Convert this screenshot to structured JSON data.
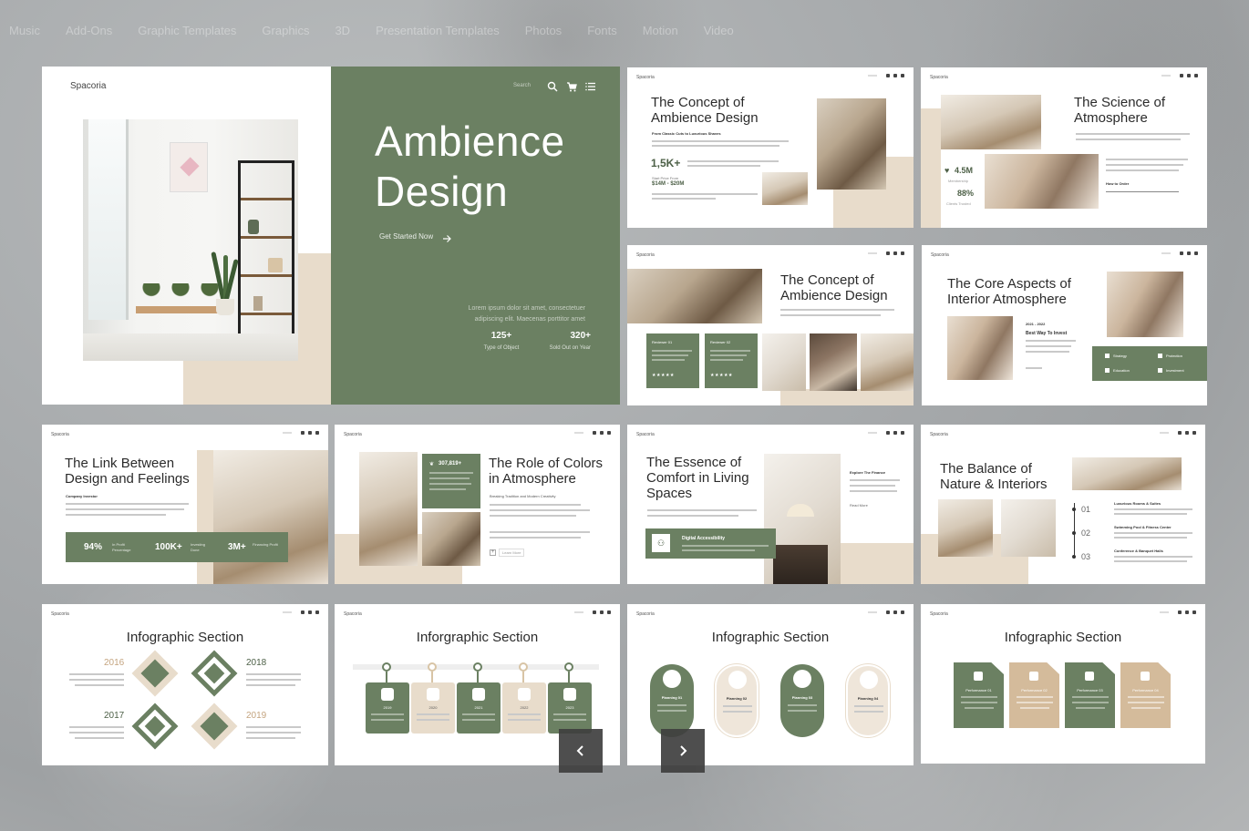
{
  "topnav": [
    "Music",
    "Add-Ons",
    "Graphic Templates",
    "Graphics",
    "3D",
    "Presentation Templates",
    "Photos",
    "Fonts",
    "Motion",
    "Video"
  ],
  "hero": {
    "logo": "Spacoria",
    "search": "Search",
    "title_line1": "Ambience",
    "title_line2": "Design",
    "cta": "Get Started Now",
    "lorem_line1": "Lorem ipsum dolor sit amet, consectetuer",
    "lorem_line2": "adipiscing elit. Maecenas porttitor amet",
    "stat1_value": "125+",
    "stat1_label": "Type of Object",
    "stat2_value": "320+",
    "stat2_label": "Sold Out on Year"
  },
  "slides": {
    "s1": {
      "logo": "Spacoria",
      "title1": "The Concept of",
      "title2": "Ambience Design",
      "sub": "From Classic Cuts to Luxurious Shaves",
      "stat": "1,5K+",
      "range_label": "Start Price From",
      "range": "$14M - $20M"
    },
    "s2": {
      "logo": "Spacoria",
      "title1": "The Science of",
      "title2": "Atmosphere",
      "stat1": "4.5M",
      "stat1_label": "Membership",
      "stat2": "88%",
      "stat2_label": "Clients Trusted",
      "order": "How to Order"
    },
    "s3": {
      "logo": "Spacoria",
      "title1": "The Concept of",
      "title2": "Ambience Design",
      "card1": "Reviewer 01",
      "card2": "Reviewer 02",
      "stars": "★★★★★"
    },
    "s4": {
      "logo": "Spacoria",
      "title1": "The Core Aspects of",
      "title2": "Interior Atmosphere",
      "years": "2021 - 2022",
      "best": "Best Way To Invest",
      "chips": [
        "Strategy",
        "Protection",
        "Education",
        "Investment"
      ]
    },
    "s5": {
      "logo": "Spacoria",
      "title1": "The Link Between",
      "title2": "Design and Feelings",
      "company": "Company Investor",
      "stats": [
        {
          "v": "94%",
          "l": "In Profit Percentage"
        },
        {
          "v": "100K+",
          "l": "Investing Done"
        },
        {
          "v": "3M+",
          "l": "Financing Profit"
        }
      ]
    },
    "s6": {
      "logo": "Spacoria",
      "title1": "The Role of Colors",
      "title2": "in Atmosphere",
      "stat": "307,819+",
      "sub": "Breaking Tradition and Modern Creativity",
      "btn": "Learn More"
    },
    "s7": {
      "logo": "Spacoria",
      "title1": "The Essence of",
      "title2": "Comfort in Living",
      "title3": "Spaces",
      "side": "Explore The Finance",
      "side2": "Read More",
      "card": "Digital Accessibility"
    },
    "s8": {
      "logo": "Spacoria",
      "title1": "The Balance of",
      "title2": "Nature & Interiors",
      "items": [
        {
          "n": "01",
          "t": "Luxurious Rooms & Suites"
        },
        {
          "n": "02",
          "t": "Swimming Pool & Fitness Center"
        },
        {
          "n": "03",
          "t": "Conference & Banquet Halls"
        }
      ]
    },
    "i1": {
      "logo": "Spacoria",
      "title": "Infographic Section",
      "years": [
        "2016",
        "2018",
        "2017",
        "2019"
      ],
      "lorem": "Lorem ipsum dolor sit amet"
    },
    "i2": {
      "logo": "Spacoria",
      "title": "Inforgraphic Section",
      "years": [
        "2019",
        "2020",
        "2021",
        "2022",
        "2023"
      ]
    },
    "i3": {
      "logo": "Spacoria",
      "title": "Infographic Section",
      "items": [
        "Planning 01",
        "Planning 02",
        "Planning 03",
        "Planning 04"
      ]
    },
    "i4": {
      "logo": "Spacoria",
      "title": "Infographic Section",
      "items": [
        "Performance 01",
        "Performance 02",
        "Performance 03",
        "Performance 04"
      ]
    }
  },
  "colors": {
    "sage": "#6b8062",
    "beige": "#e8dccb",
    "dark": "#2b2b2b"
  }
}
